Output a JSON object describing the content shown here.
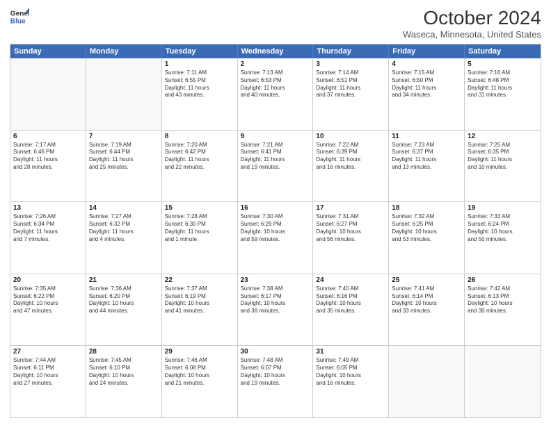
{
  "logo": {
    "general": "General",
    "blue": "Blue"
  },
  "header": {
    "title": "October 2024",
    "subtitle": "Waseca, Minnesota, United States"
  },
  "weekdays": [
    "Sunday",
    "Monday",
    "Tuesday",
    "Wednesday",
    "Thursday",
    "Friday",
    "Saturday"
  ],
  "rows": [
    [
      {
        "day": "",
        "lines": [],
        "empty": true
      },
      {
        "day": "",
        "lines": [],
        "empty": true
      },
      {
        "day": "1",
        "lines": [
          "Sunrise: 7:11 AM",
          "Sunset: 6:55 PM",
          "Daylight: 11 hours",
          "and 43 minutes."
        ]
      },
      {
        "day": "2",
        "lines": [
          "Sunrise: 7:13 AM",
          "Sunset: 6:53 PM",
          "Daylight: 11 hours",
          "and 40 minutes."
        ]
      },
      {
        "day": "3",
        "lines": [
          "Sunrise: 7:14 AM",
          "Sunset: 6:51 PM",
          "Daylight: 11 hours",
          "and 37 minutes."
        ]
      },
      {
        "day": "4",
        "lines": [
          "Sunrise: 7:15 AM",
          "Sunset: 6:50 PM",
          "Daylight: 11 hours",
          "and 34 minutes."
        ]
      },
      {
        "day": "5",
        "lines": [
          "Sunrise: 7:16 AM",
          "Sunset: 6:48 PM",
          "Daylight: 11 hours",
          "and 31 minutes."
        ]
      }
    ],
    [
      {
        "day": "6",
        "lines": [
          "Sunrise: 7:17 AM",
          "Sunset: 6:46 PM",
          "Daylight: 11 hours",
          "and 28 minutes."
        ]
      },
      {
        "day": "7",
        "lines": [
          "Sunrise: 7:19 AM",
          "Sunset: 6:44 PM",
          "Daylight: 11 hours",
          "and 25 minutes."
        ]
      },
      {
        "day": "8",
        "lines": [
          "Sunrise: 7:20 AM",
          "Sunset: 6:42 PM",
          "Daylight: 11 hours",
          "and 22 minutes."
        ]
      },
      {
        "day": "9",
        "lines": [
          "Sunrise: 7:21 AM",
          "Sunset: 6:41 PM",
          "Daylight: 11 hours",
          "and 19 minutes."
        ]
      },
      {
        "day": "10",
        "lines": [
          "Sunrise: 7:22 AM",
          "Sunset: 6:39 PM",
          "Daylight: 11 hours",
          "and 16 minutes."
        ]
      },
      {
        "day": "11",
        "lines": [
          "Sunrise: 7:23 AM",
          "Sunset: 6:37 PM",
          "Daylight: 11 hours",
          "and 13 minutes."
        ]
      },
      {
        "day": "12",
        "lines": [
          "Sunrise: 7:25 AM",
          "Sunset: 6:35 PM",
          "Daylight: 11 hours",
          "and 10 minutes."
        ]
      }
    ],
    [
      {
        "day": "13",
        "lines": [
          "Sunrise: 7:26 AM",
          "Sunset: 6:34 PM",
          "Daylight: 11 hours",
          "and 7 minutes."
        ]
      },
      {
        "day": "14",
        "lines": [
          "Sunrise: 7:27 AM",
          "Sunset: 6:32 PM",
          "Daylight: 11 hours",
          "and 4 minutes."
        ]
      },
      {
        "day": "15",
        "lines": [
          "Sunrise: 7:28 AM",
          "Sunset: 6:30 PM",
          "Daylight: 11 hours",
          "and 1 minute."
        ]
      },
      {
        "day": "16",
        "lines": [
          "Sunrise: 7:30 AM",
          "Sunset: 6:29 PM",
          "Daylight: 10 hours",
          "and 59 minutes."
        ]
      },
      {
        "day": "17",
        "lines": [
          "Sunrise: 7:31 AM",
          "Sunset: 6:27 PM",
          "Daylight: 10 hours",
          "and 56 minutes."
        ]
      },
      {
        "day": "18",
        "lines": [
          "Sunrise: 7:32 AM",
          "Sunset: 6:25 PM",
          "Daylight: 10 hours",
          "and 53 minutes."
        ]
      },
      {
        "day": "19",
        "lines": [
          "Sunrise: 7:33 AM",
          "Sunset: 6:24 PM",
          "Daylight: 10 hours",
          "and 50 minutes."
        ]
      }
    ],
    [
      {
        "day": "20",
        "lines": [
          "Sunrise: 7:35 AM",
          "Sunset: 6:22 PM",
          "Daylight: 10 hours",
          "and 47 minutes."
        ]
      },
      {
        "day": "21",
        "lines": [
          "Sunrise: 7:36 AM",
          "Sunset: 6:20 PM",
          "Daylight: 10 hours",
          "and 44 minutes."
        ]
      },
      {
        "day": "22",
        "lines": [
          "Sunrise: 7:37 AM",
          "Sunset: 6:19 PM",
          "Daylight: 10 hours",
          "and 41 minutes."
        ]
      },
      {
        "day": "23",
        "lines": [
          "Sunrise: 7:38 AM",
          "Sunset: 6:17 PM",
          "Daylight: 10 hours",
          "and 38 minutes."
        ]
      },
      {
        "day": "24",
        "lines": [
          "Sunrise: 7:40 AM",
          "Sunset: 6:16 PM",
          "Daylight: 10 hours",
          "and 35 minutes."
        ]
      },
      {
        "day": "25",
        "lines": [
          "Sunrise: 7:41 AM",
          "Sunset: 6:14 PM",
          "Daylight: 10 hours",
          "and 33 minutes."
        ]
      },
      {
        "day": "26",
        "lines": [
          "Sunrise: 7:42 AM",
          "Sunset: 6:13 PM",
          "Daylight: 10 hours",
          "and 30 minutes."
        ]
      }
    ],
    [
      {
        "day": "27",
        "lines": [
          "Sunrise: 7:44 AM",
          "Sunset: 6:11 PM",
          "Daylight: 10 hours",
          "and 27 minutes."
        ]
      },
      {
        "day": "28",
        "lines": [
          "Sunrise: 7:45 AM",
          "Sunset: 6:10 PM",
          "Daylight: 10 hours",
          "and 24 minutes."
        ]
      },
      {
        "day": "29",
        "lines": [
          "Sunrise: 7:46 AM",
          "Sunset: 6:08 PM",
          "Daylight: 10 hours",
          "and 21 minutes."
        ]
      },
      {
        "day": "30",
        "lines": [
          "Sunrise: 7:48 AM",
          "Sunset: 6:07 PM",
          "Daylight: 10 hours",
          "and 19 minutes."
        ]
      },
      {
        "day": "31",
        "lines": [
          "Sunrise: 7:49 AM",
          "Sunset: 6:05 PM",
          "Daylight: 10 hours",
          "and 16 minutes."
        ]
      },
      {
        "day": "",
        "lines": [],
        "empty": true
      },
      {
        "day": "",
        "lines": [],
        "empty": true
      }
    ]
  ]
}
